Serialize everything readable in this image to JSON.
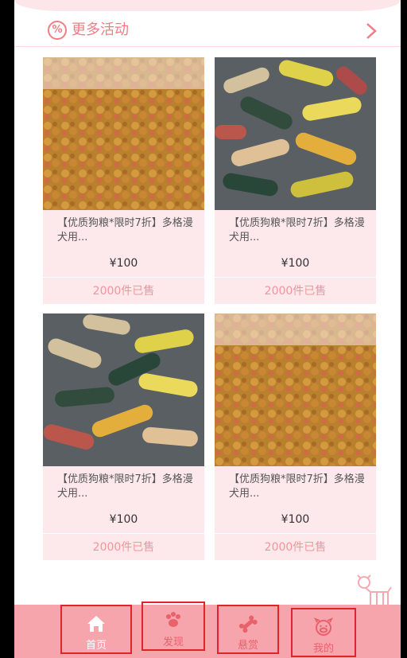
{
  "more": {
    "label": "更多活动",
    "icon": "percent-badge-icon",
    "chevron": "chevron-right-icon"
  },
  "products": [
    {
      "title": "【优质狗粮*限时7折】多格漫犬用...",
      "price": "¥100",
      "sold": "2000件已售",
      "image": "kibble-photo"
    },
    {
      "title": "【优质狗粮*限时7折】多格漫犬用...",
      "price": "¥100",
      "sold": "2000件已售",
      "image": "bone-biscuits-photo"
    },
    {
      "title": "【优质狗粮*限时7折】多格漫犬用...",
      "price": "¥100",
      "sold": "2000件已售",
      "image": "bone-biscuits-photo"
    },
    {
      "title": "【优质狗粮*限时7折】多格漫犬用...",
      "price": "¥100",
      "sold": "2000件已售",
      "image": "kibble-photo"
    }
  ],
  "tabs": [
    {
      "label": "首页",
      "icon": "home-icon"
    },
    {
      "label": "发现",
      "icon": "paw-icon"
    },
    {
      "label": "悬赏",
      "icon": "bone-icon"
    },
    {
      "label": "我的",
      "icon": "pig-face-icon"
    }
  ],
  "colors": {
    "accent": "#f07d86",
    "tabbar": "#f7a5ad",
    "card": "#fde8eb",
    "highlight_box": "#e0242b"
  }
}
